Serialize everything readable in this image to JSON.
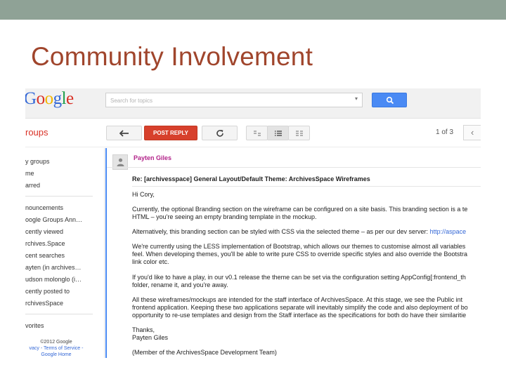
{
  "slide": {
    "title": "Community Involvement"
  },
  "colors": {
    "top_bar": "#8fa296",
    "title": "#a0452c",
    "accent_blue": "#4a8af4",
    "reply_red": "#d7402c",
    "author_magenta": "#b3238a"
  },
  "header": {
    "logo": [
      "G",
      "o",
      "o",
      "g",
      "l",
      "e"
    ],
    "search_placeholder": "Search for topics",
    "search_button_icon": "search-icon"
  },
  "toolbar": {
    "section_label": "roups",
    "back_icon": "back-arrow-icon",
    "post_reply_label": "POST REPLY",
    "refresh_icon": "refresh-icon",
    "view_icons": [
      "threaded-view-icon",
      "list-view-icon",
      "grid-view-icon"
    ],
    "pager": "1 of 3",
    "prev_icon": "chevron-left-icon"
  },
  "sidebar": {
    "top_items": [
      "y groups",
      "me",
      "arred"
    ],
    "recent_items": [
      "nouncements",
      "oogle Groups Ann…",
      "cently viewed",
      "rchives.Space",
      "cent searches",
      "ayten (in archives…",
      "udson molonglo (i…",
      "cently posted to",
      "rchivesSpace"
    ],
    "bottom_items": [
      "vorites"
    ],
    "footer": {
      "copyright": "©2012 Google",
      "privacy": "vacy",
      "sep1": " - ",
      "terms": "Terms of Service",
      "sep2": " -",
      "home": "Google Home"
    }
  },
  "message": {
    "author": "Payten Giles",
    "avatar_icon": "person-icon",
    "subject": "Re: [archivesspace] General Layout/Default Theme: ArchivesSpace Wireframes",
    "greeting": "Hi Cory,",
    "p1_line1": "Currently, the optional Branding section on the wireframe can be configured on a site basis.  This branding section is a te",
    "p1_line2": "HTML – you're seeing an empty branding template in the mockup.",
    "p2_text": "Alternatively, this branding section can be styled with CSS via the selected theme – as per our dev server: ",
    "p2_link": "http://aspace",
    "p3_line1": "We're currently using the LESS implementation of Bootstrap, which allows our themes to customise almost all variables",
    "p3_line2": "feel.  When developing themes, you'll be able to write pure CSS to override specific styles and also override the Bootstra",
    "p3_line3": "link color etc.",
    "p4_line1": "If you'd like to have a play, in our v0.1 release the theme can be set via the configuration setting AppConfig[:frontend_th",
    "p4_line2": "folder, rename it, and you're away.",
    "p5_line1": "All these wireframes/mockups are intended for the staff interface of ArchivesSpace.  At this stage, we see the Public int",
    "p5_line2": "frontend application.  Keeping these two applications separate will inevitably simplify the code and also deployment of bo",
    "p5_line3": "opportunity to re-use templates and design from the Staff interface as the specifications for both do have their similaritie",
    "sign1": "Thanks,",
    "sign2": "Payten Giles",
    "sign3": "(Member of the ArchivesSpace Development Team)"
  }
}
